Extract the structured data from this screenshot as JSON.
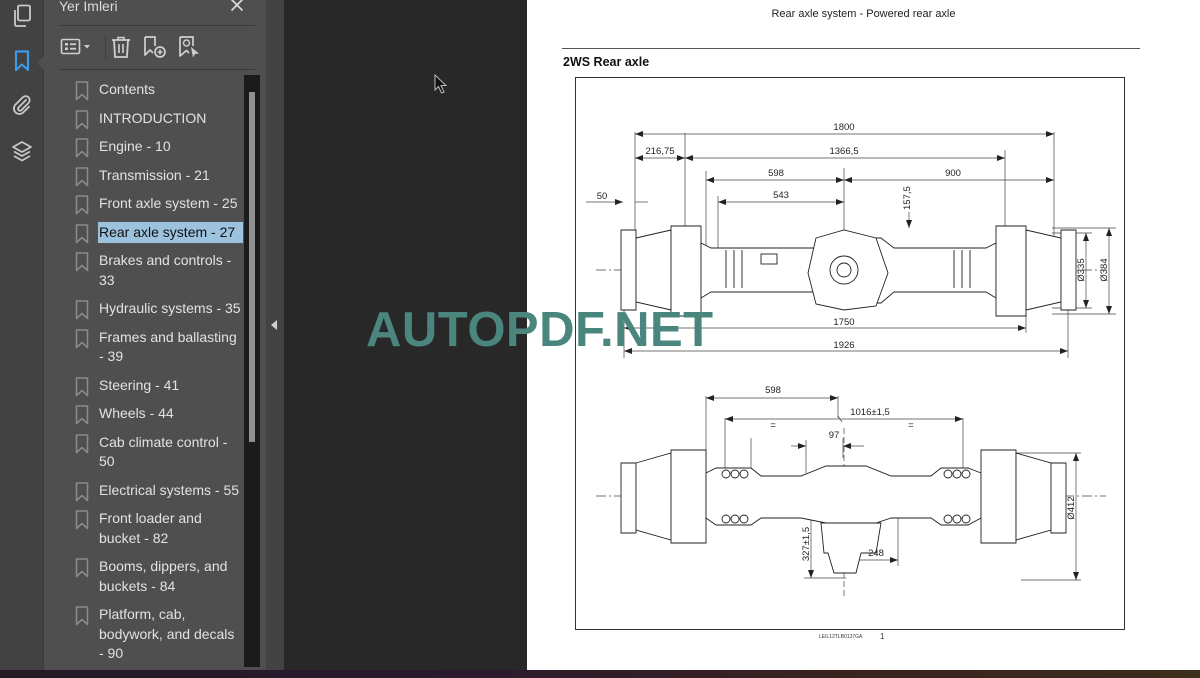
{
  "rail": {
    "icons": [
      "pages-icon",
      "bookmark-icon",
      "attachment-icon",
      "layers-icon"
    ],
    "active_color": "#3d9ae8"
  },
  "bookmarks_panel": {
    "title": "Yer Imleri",
    "close_icon": "close-icon",
    "toolbar": [
      "options-menu",
      "delete-bookmark",
      "add-bookmark",
      "find-current-bookmark"
    ],
    "items": [
      {
        "label": "Contents"
      },
      {
        "label": "INTRODUCTION"
      },
      {
        "label": "Engine - 10"
      },
      {
        "label": "Transmission - 21"
      },
      {
        "label": "Front axle system - 25"
      },
      {
        "label": "Rear axle system - 27",
        "selected": true
      },
      {
        "label": "Brakes and controls - 33"
      },
      {
        "label": "Hydraulic systems - 35"
      },
      {
        "label": "Frames and ballasting - 39"
      },
      {
        "label": "Steering - 41"
      },
      {
        "label": "Wheels - 44"
      },
      {
        "label": "Cab climate control - 50"
      },
      {
        "label": "Electrical systems - 55"
      },
      {
        "label": "Front loader and bucket - 82"
      },
      {
        "label": "Booms, dippers, and buckets - 84"
      },
      {
        "label": "Platform, cab, bodywork, and decals - 90"
      }
    ],
    "selected_color": "#9cc2de"
  },
  "document": {
    "running_header": "Rear axle system - Powered rear axle",
    "section_title": "2WS Rear axle",
    "figure": {
      "top_view_dimensions": [
        "1800",
        "216,75",
        "1366,5",
        "598",
        "900",
        "50",
        "543",
        "157,5",
        "Ø335",
        "Ø384",
        "1750",
        "1926"
      ],
      "bottom_view_dimensions": [
        "598",
        "1016±1,5",
        "=",
        "=",
        "97",
        "Ø412",
        "327±1,5",
        "248"
      ],
      "caption_code": "LEIL12TLB0137GA",
      "caption_number": "1"
    }
  },
  "watermark": {
    "text": "AUTOPDF.NET",
    "color": "#4a857e"
  }
}
